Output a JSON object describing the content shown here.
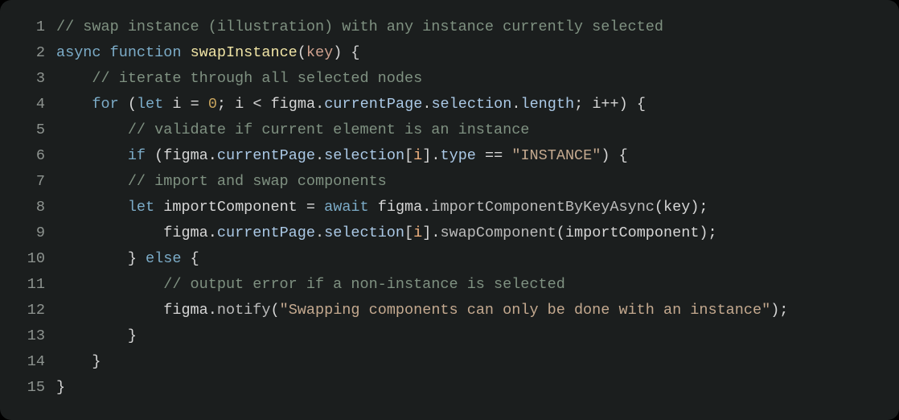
{
  "colors": {
    "background": "#1b1e1e",
    "lineNumber": "#8e9490",
    "comment": "#7f9181",
    "keyword": "#7cacc8",
    "functionName": "#f0e4a5",
    "param": "#cfa28f",
    "property": "#abc9e6",
    "number": "#c8a45d",
    "string": "#c4a98f",
    "default": "#d6d6d6",
    "highlight": "#f1b27f"
  },
  "lines": [
    {
      "n": "1",
      "indent": "",
      "tokens": [
        {
          "c": "c-comment",
          "t": "// swap instance (illustration) with any instance currently selected"
        }
      ]
    },
    {
      "n": "2",
      "indent": "",
      "tokens": [
        {
          "c": "c-keyword",
          "t": "async"
        },
        {
          "c": "c-punct",
          "t": " "
        },
        {
          "c": "c-keyword",
          "t": "function"
        },
        {
          "c": "c-punct",
          "t": " "
        },
        {
          "c": "c-fnname",
          "t": "swapInstance"
        },
        {
          "c": "c-punct",
          "t": "("
        },
        {
          "c": "c-param",
          "t": "key"
        },
        {
          "c": "c-punct",
          "t": ") {"
        }
      ]
    },
    {
      "n": "3",
      "indent": "    ",
      "tokens": [
        {
          "c": "c-comment",
          "t": "// iterate through all selected nodes"
        }
      ]
    },
    {
      "n": "4",
      "indent": "    ",
      "tokens": [
        {
          "c": "c-keyword",
          "t": "for"
        },
        {
          "c": "c-punct",
          "t": " ("
        },
        {
          "c": "c-keyword",
          "t": "let"
        },
        {
          "c": "c-punct",
          "t": " "
        },
        {
          "c": "c-ident",
          "t": "i"
        },
        {
          "c": "c-punct",
          "t": " "
        },
        {
          "c": "c-op",
          "t": "="
        },
        {
          "c": "c-punct",
          "t": " "
        },
        {
          "c": "c-num",
          "t": "0"
        },
        {
          "c": "c-punct",
          "t": "; "
        },
        {
          "c": "c-ident",
          "t": "i"
        },
        {
          "c": "c-punct",
          "t": " "
        },
        {
          "c": "c-op",
          "t": "<"
        },
        {
          "c": "c-punct",
          "t": " "
        },
        {
          "c": "c-ident",
          "t": "figma"
        },
        {
          "c": "c-punct",
          "t": "."
        },
        {
          "c": "c-prop",
          "t": "currentPage"
        },
        {
          "c": "c-punct",
          "t": "."
        },
        {
          "c": "c-prop",
          "t": "selection"
        },
        {
          "c": "c-punct",
          "t": "."
        },
        {
          "c": "c-prop",
          "t": "length"
        },
        {
          "c": "c-punct",
          "t": "; "
        },
        {
          "c": "c-ident",
          "t": "i"
        },
        {
          "c": "c-op",
          "t": "++"
        },
        {
          "c": "c-punct",
          "t": ") {"
        }
      ]
    },
    {
      "n": "5",
      "indent": "        ",
      "tokens": [
        {
          "c": "c-comment",
          "t": "// validate if current element is an instance"
        }
      ]
    },
    {
      "n": "6",
      "indent": "        ",
      "tokens": [
        {
          "c": "c-keyword",
          "t": "if"
        },
        {
          "c": "c-punct",
          "t": " ("
        },
        {
          "c": "c-ident",
          "t": "figma"
        },
        {
          "c": "c-punct",
          "t": "."
        },
        {
          "c": "c-prop",
          "t": "currentPage"
        },
        {
          "c": "c-punct",
          "t": "."
        },
        {
          "c": "c-prop",
          "t": "selection"
        },
        {
          "c": "c-punct",
          "t": "["
        },
        {
          "c": "c-highlight",
          "t": "i"
        },
        {
          "c": "c-punct",
          "t": "]."
        },
        {
          "c": "c-prop",
          "t": "type"
        },
        {
          "c": "c-punct",
          "t": " "
        },
        {
          "c": "c-op",
          "t": "=="
        },
        {
          "c": "c-punct",
          "t": " "
        },
        {
          "c": "c-string",
          "t": "\"INSTANCE\""
        },
        {
          "c": "c-punct",
          "t": ") {"
        }
      ]
    },
    {
      "n": "7",
      "indent": "        ",
      "tokens": [
        {
          "c": "c-comment",
          "t": "// import and swap components"
        }
      ]
    },
    {
      "n": "8",
      "indent": "        ",
      "tokens": [
        {
          "c": "c-keyword",
          "t": "let"
        },
        {
          "c": "c-punct",
          "t": " "
        },
        {
          "c": "c-ident",
          "t": "importComponent"
        },
        {
          "c": "c-punct",
          "t": " "
        },
        {
          "c": "c-op",
          "t": "="
        },
        {
          "c": "c-punct",
          "t": " "
        },
        {
          "c": "c-keyword",
          "t": "await"
        },
        {
          "c": "c-punct",
          "t": " "
        },
        {
          "c": "c-ident",
          "t": "figma"
        },
        {
          "c": "c-punct",
          "t": "."
        },
        {
          "c": "c-call",
          "t": "importComponentByKeyAsync"
        },
        {
          "c": "c-punct",
          "t": "("
        },
        {
          "c": "c-ident",
          "t": "key"
        },
        {
          "c": "c-punct",
          "t": ");"
        }
      ]
    },
    {
      "n": "9",
      "indent": "            ",
      "tokens": [
        {
          "c": "c-ident",
          "t": "figma"
        },
        {
          "c": "c-punct",
          "t": "."
        },
        {
          "c": "c-prop",
          "t": "currentPage"
        },
        {
          "c": "c-punct",
          "t": "."
        },
        {
          "c": "c-prop",
          "t": "selection"
        },
        {
          "c": "c-punct",
          "t": "["
        },
        {
          "c": "c-highlight",
          "t": "i"
        },
        {
          "c": "c-punct",
          "t": "]."
        },
        {
          "c": "c-call",
          "t": "swapComponent"
        },
        {
          "c": "c-punct",
          "t": "("
        },
        {
          "c": "c-ident",
          "t": "importComponent"
        },
        {
          "c": "c-punct",
          "t": ");"
        }
      ]
    },
    {
      "n": "10",
      "indent": "        ",
      "tokens": [
        {
          "c": "c-punct",
          "t": "} "
        },
        {
          "c": "c-keyword",
          "t": "else"
        },
        {
          "c": "c-punct",
          "t": " {"
        }
      ]
    },
    {
      "n": "11",
      "indent": "            ",
      "tokens": [
        {
          "c": "c-comment",
          "t": "// output error if a non-instance is selected"
        }
      ]
    },
    {
      "n": "12",
      "indent": "            ",
      "tokens": [
        {
          "c": "c-ident",
          "t": "figma"
        },
        {
          "c": "c-punct",
          "t": "."
        },
        {
          "c": "c-call",
          "t": "notify"
        },
        {
          "c": "c-punct",
          "t": "("
        },
        {
          "c": "c-string",
          "t": "\"Swapping components can only be done with an instance\""
        },
        {
          "c": "c-punct",
          "t": ");"
        }
      ]
    },
    {
      "n": "13",
      "indent": "        ",
      "tokens": [
        {
          "c": "c-punct",
          "t": "}"
        }
      ]
    },
    {
      "n": "14",
      "indent": "    ",
      "tokens": [
        {
          "c": "c-punct",
          "t": "}"
        }
      ]
    },
    {
      "n": "15",
      "indent": "",
      "tokens": [
        {
          "c": "c-punct",
          "t": "}"
        }
      ]
    }
  ]
}
